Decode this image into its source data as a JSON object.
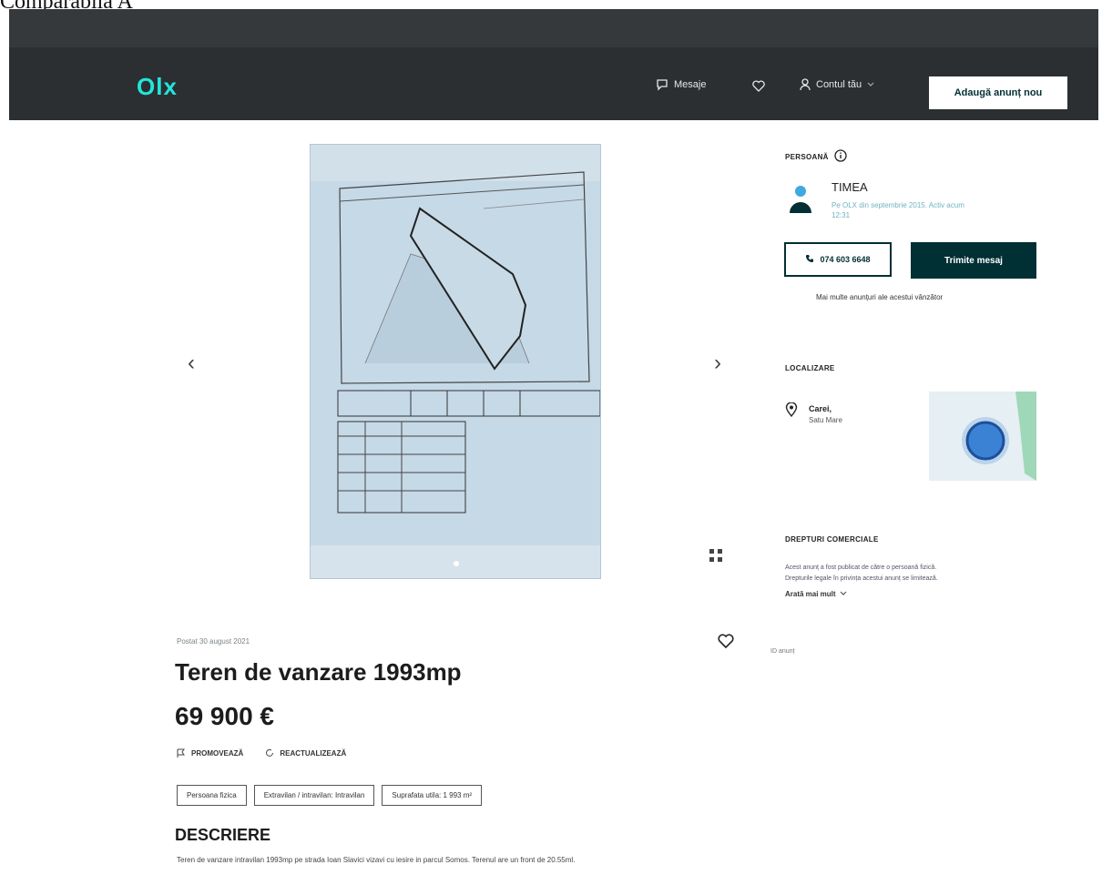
{
  "document": {
    "title": "Comparabila A"
  },
  "header": {
    "logo": "Olx",
    "messages_label": "Mesaje",
    "account_label": "Contul tău",
    "add_ad_label": "Adaugă anunț nou"
  },
  "listing": {
    "posted": "Postat 30 august 2021",
    "title": "Teren de vanzare 1993mp",
    "price": "69 900 €",
    "promote_label": "PROMOVEAZĂ",
    "refresh_label": "REACTUALIZEAZĂ",
    "tags": [
      "Persoana fizica",
      "Extravilan / intravilan: Intravilan",
      "Suprafata utila: 1 993 m²"
    ],
    "description_heading": "DESCRIERE",
    "description": "Teren de vanzare intravilan 1993mp pe strada Ioan Slavici vizavi cu iesire in parcul Somos. Terenul are un front de 20.55ml."
  },
  "seller": {
    "section_label": "PERSOANĂ",
    "name": "TIMEA",
    "subtitle": "Pe OLX din septembrie 2015. Activ acum 12:31",
    "phone": "074 603 6648",
    "message_button": "Trimite mesaj",
    "more_ads": "Mai multe anunțuri ale acestui vânzător"
  },
  "location": {
    "section_label": "LOCALIZARE",
    "city": "Carei,",
    "county": "Satu Mare"
  },
  "rights": {
    "section_label": "DREPTURI COMERCIALE",
    "line1": "Acest anunț a fost publicat de către o persoană fizică.",
    "line2": "Drepturile legale în privința acestui anunț se limitează.",
    "see_more": "Arată mai mult"
  },
  "id_text": "ID anunț",
  "colors": {
    "brand_dark": "#002f34",
    "logo_accent": "#23e5db",
    "header_bg": "#2b2f31"
  }
}
